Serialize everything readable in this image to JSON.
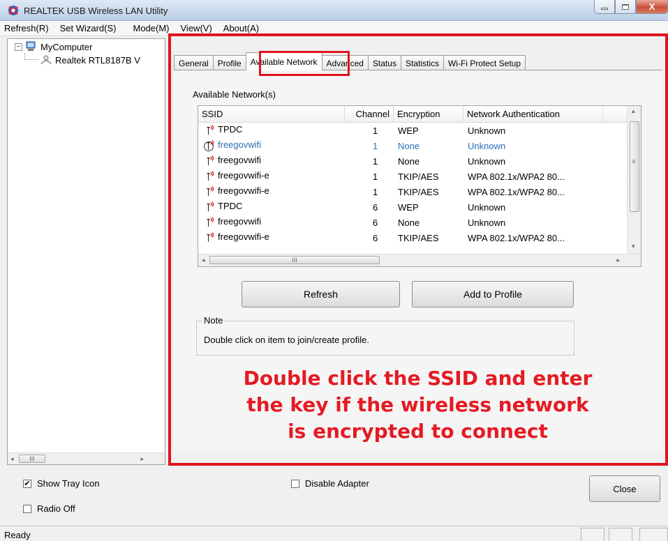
{
  "window": {
    "title": "REALTEK USB Wireless LAN Utility",
    "min_glyph": "▭",
    "max_glyph": "□",
    "close_glyph": "X"
  },
  "menu": [
    "Refresh(R)",
    "Set Wizard(S)",
    "Mode(M)",
    "View(V)",
    "About(A)"
  ],
  "tree": {
    "root_label": "MyComputer",
    "expander": "⊟",
    "child_label": "Realtek RTL8187B V",
    "scroll_thumb": "III",
    "left_arrow": "◂",
    "right_arrow": "▸"
  },
  "tabs": [
    {
      "label": "General",
      "active": false
    },
    {
      "label": "Profile",
      "active": false
    },
    {
      "label": "Available Network",
      "active": true
    },
    {
      "label": "Advanced",
      "active": false
    },
    {
      "label": "Status",
      "active": false
    },
    {
      "label": "Statistics",
      "active": false
    },
    {
      "label": "Wi-Fi Protect Setup",
      "active": false
    }
  ],
  "available": {
    "group_label": "Available Network(s)",
    "columns": [
      "SSID",
      "Channel",
      "Encryption",
      "Network Authentication"
    ],
    "rows": [
      {
        "ssid": "TPDC",
        "channel": "1",
        "encryption": "WEP",
        "auth": "Unknown",
        "selected": false
      },
      {
        "ssid": "freegovwifi",
        "channel": "1",
        "encryption": "None",
        "auth": "Unknown",
        "selected": true
      },
      {
        "ssid": "freegovwifi",
        "channel": "1",
        "encryption": "None",
        "auth": "Unknown",
        "selected": false
      },
      {
        "ssid": "freegovwifi-e",
        "channel": "1",
        "encryption": "TKIP/AES",
        "auth": "WPA 802.1x/WPA2 80...",
        "selected": false
      },
      {
        "ssid": "freegovwifi-e",
        "channel": "1",
        "encryption": "TKIP/AES",
        "auth": "WPA 802.1x/WPA2 80...",
        "selected": false
      },
      {
        "ssid": "TPDC",
        "channel": "6",
        "encryption": "WEP",
        "auth": "Unknown",
        "selected": false
      },
      {
        "ssid": "freegovwifi",
        "channel": "6",
        "encryption": "None",
        "auth": "Unknown",
        "selected": false
      },
      {
        "ssid": "freegovwifi-e",
        "channel": "6",
        "encryption": "TKIP/AES",
        "auth": "WPA 802.1x/WPA2 80...",
        "selected": false
      }
    ],
    "vscroll_up": "▴",
    "vscroll_down": "▾",
    "vscroll_grip": "≡",
    "hscroll_thumb": "III",
    "left_arrow": "◂",
    "right_arrow": "▸"
  },
  "buttons": {
    "refresh": "Refresh",
    "add_to_profile": "Add to Profile",
    "close": "Close"
  },
  "note": {
    "title": "Note",
    "text": "Double click on item to join/create profile."
  },
  "instruction_lines": [
    "Double click the SSID and enter",
    "the key if the wireless network",
    "is encrypted to connect"
  ],
  "options": {
    "show_tray_icon": {
      "label": "Show Tray Icon",
      "checked": true
    },
    "radio_off": {
      "label": "Radio Off",
      "checked": false
    },
    "disable_adapter": {
      "label": "Disable Adapter",
      "checked": false
    },
    "check_mark": "✔"
  },
  "status": {
    "text": "Ready"
  },
  "colors": {
    "annotation_red": "#e0141e",
    "selected_row_text": "#2a6db4"
  }
}
